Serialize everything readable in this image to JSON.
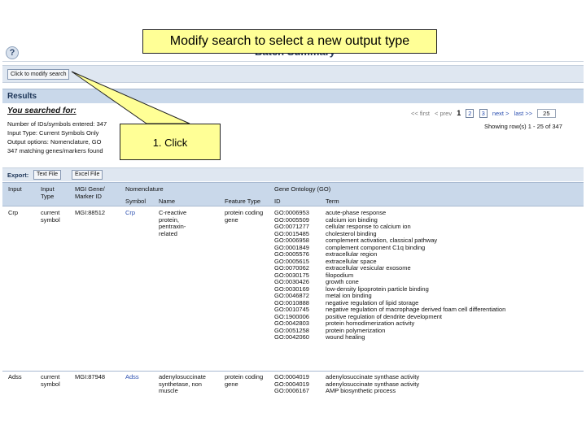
{
  "callouts": {
    "main": "Modify search to select a new output type",
    "click": "1. Click"
  },
  "header": {
    "help_icon": "?",
    "title": "Batch Summary"
  },
  "modify": {
    "button_label": "Click to modify search"
  },
  "results": {
    "title": "Results"
  },
  "summary": {
    "heading": "You searched for:",
    "lines": [
      "Number of IDs/symbols entered: 347",
      "Input Type: Current Symbols Only",
      "Output options: Nomenclature, GO",
      "347 matching genes/markers found"
    ]
  },
  "pager": {
    "first": "<< first",
    "prev": "< prev",
    "current": "1",
    "page2": "2",
    "page3": "3",
    "next": "next >",
    "last": "last >>",
    "page_size": "25",
    "showing": "Showing row(s) 1 - 25 of 347"
  },
  "export": {
    "label": "Export:",
    "text_file": "Text File",
    "excel_file": "Excel File"
  },
  "table": {
    "headers": {
      "input": "Input",
      "input_type": "Input Type",
      "marker_id": "MGI Gene/ Marker ID",
      "nomenclature": "Nomenclature",
      "symbol": "Symbol",
      "name": "Name",
      "feature_type": "Feature Type",
      "go": "Gene Ontology (GO)",
      "go_id": "ID",
      "go_term": "Term"
    },
    "rows": [
      {
        "input": "Crp",
        "input_type": "current symbol",
        "marker_id": "MGI:88512",
        "symbol": "Crp",
        "name": "C-reactive protein, pentraxin-related",
        "feature_type": "protein coding gene",
        "go": [
          [
            "GO:0006953",
            "acute-phase response"
          ],
          [
            "GO:0005509",
            "calcium ion binding"
          ],
          [
            "GO:0071277",
            "cellular response to calcium ion"
          ],
          [
            "GO:0015485",
            "cholesterol binding"
          ],
          [
            "GO:0006958",
            "complement activation, classical pathway"
          ],
          [
            "GO:0001849",
            "complement component C1q binding"
          ],
          [
            "GO:0005576",
            "extracellular region"
          ],
          [
            "GO:0005615",
            "extracellular space"
          ],
          [
            "GO:0070062",
            "extracellular vesicular exosome"
          ],
          [
            "GO:0030175",
            "filopodium"
          ],
          [
            "GO:0030426",
            "growth cone"
          ],
          [
            "GO:0030169",
            "low-density lipoprotein particle binding"
          ],
          [
            "GO:0046872",
            "metal ion binding"
          ],
          [
            "GO:0010888",
            "negative regulation of lipid storage"
          ],
          [
            "GO:0010745",
            "negative regulation of macrophage derived foam cell differentiation"
          ],
          [
            "GO:1900006",
            "positive regulation of dendrite development"
          ],
          [
            "GO:0042803",
            "protein homodimerization activity"
          ],
          [
            "GO:0051258",
            "protein polymerization"
          ],
          [
            "GO:0042060",
            "wound healing"
          ]
        ]
      },
      {
        "input": "Adss",
        "input_type": "current symbol",
        "marker_id": "MGI:87948",
        "symbol": "Adss",
        "name": "adenylosuccinate synthetase, non muscle",
        "feature_type": "protein coding gene",
        "go": [
          [
            "GO:0004019",
            "adenylosuccinate synthase activity"
          ],
          [
            "GO:0004019",
            "adenylosuccinate synthase activity"
          ],
          [
            "GO:0006167",
            "AMP biosynthetic process"
          ]
        ]
      }
    ]
  }
}
